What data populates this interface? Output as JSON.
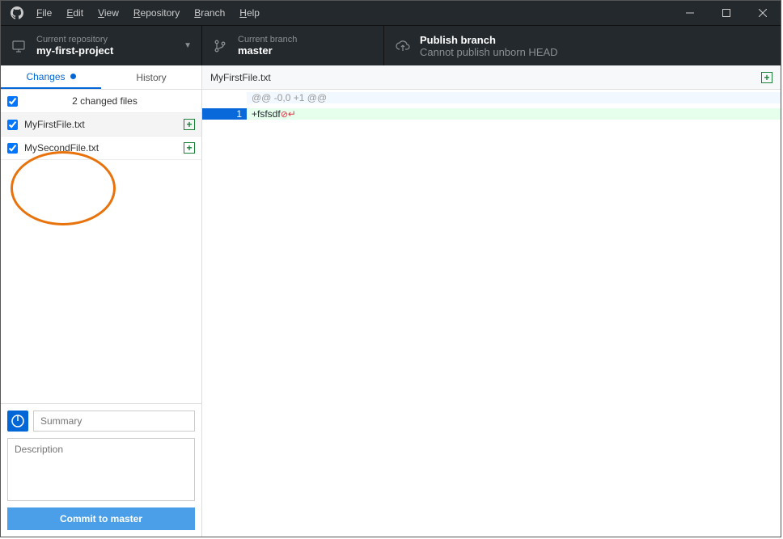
{
  "menu": {
    "file": "File",
    "edit": "Edit",
    "view": "View",
    "repository": "Repository",
    "branch": "Branch",
    "help": "Help"
  },
  "header": {
    "repo": {
      "label": "Current repository",
      "value": "my-first-project"
    },
    "branch": {
      "label": "Current branch",
      "value": "master"
    },
    "publish": {
      "label": "Publish branch",
      "value": "Cannot publish unborn HEAD"
    }
  },
  "tabs": {
    "changes": "Changes",
    "history": "History"
  },
  "changed_header": "2 changed files",
  "files": [
    {
      "name": "MyFirstFile.txt",
      "selected": true
    },
    {
      "name": "MySecondFile.txt",
      "selected": false
    }
  ],
  "commit": {
    "summary_placeholder": "Summary",
    "description_placeholder": "Description",
    "button_prefix": "Commit to ",
    "button_branch": "master"
  },
  "diff": {
    "filename": "MyFirstFile.txt",
    "hunk": "@@ -0,0 +1 @@",
    "lines": [
      {
        "num": "1",
        "prefix": "+",
        "text": "fsfsdf",
        "noeol": true
      }
    ]
  }
}
